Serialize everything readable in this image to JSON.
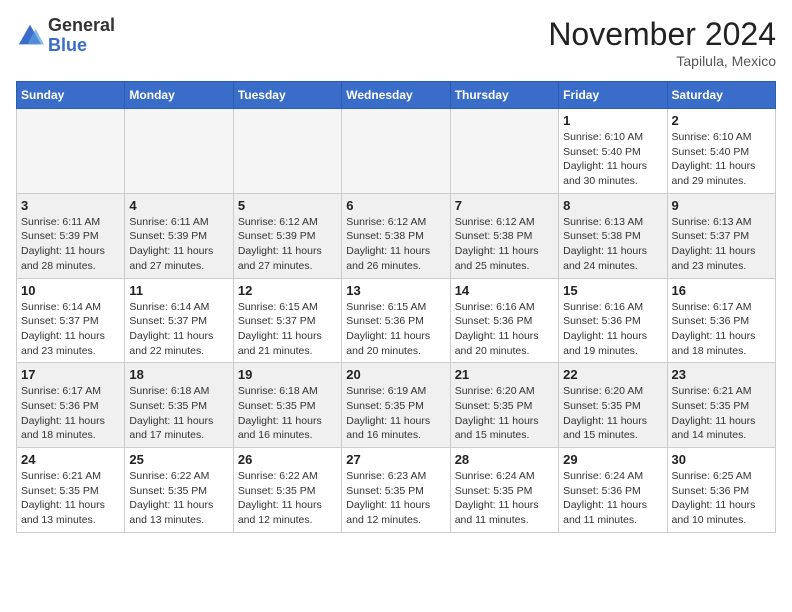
{
  "header": {
    "logo_general": "General",
    "logo_blue": "Blue",
    "month_title": "November 2024",
    "location": "Tapilula, Mexico"
  },
  "weekdays": [
    "Sunday",
    "Monday",
    "Tuesday",
    "Wednesday",
    "Thursday",
    "Friday",
    "Saturday"
  ],
  "weeks": [
    [
      {
        "day": "",
        "info": ""
      },
      {
        "day": "",
        "info": ""
      },
      {
        "day": "",
        "info": ""
      },
      {
        "day": "",
        "info": ""
      },
      {
        "day": "",
        "info": ""
      },
      {
        "day": "1",
        "info": "Sunrise: 6:10 AM\nSunset: 5:40 PM\nDaylight: 11 hours\nand 30 minutes."
      },
      {
        "day": "2",
        "info": "Sunrise: 6:10 AM\nSunset: 5:40 PM\nDaylight: 11 hours\nand 29 minutes."
      }
    ],
    [
      {
        "day": "3",
        "info": "Sunrise: 6:11 AM\nSunset: 5:39 PM\nDaylight: 11 hours\nand 28 minutes."
      },
      {
        "day": "4",
        "info": "Sunrise: 6:11 AM\nSunset: 5:39 PM\nDaylight: 11 hours\nand 27 minutes."
      },
      {
        "day": "5",
        "info": "Sunrise: 6:12 AM\nSunset: 5:39 PM\nDaylight: 11 hours\nand 27 minutes."
      },
      {
        "day": "6",
        "info": "Sunrise: 6:12 AM\nSunset: 5:38 PM\nDaylight: 11 hours\nand 26 minutes."
      },
      {
        "day": "7",
        "info": "Sunrise: 6:12 AM\nSunset: 5:38 PM\nDaylight: 11 hours\nand 25 minutes."
      },
      {
        "day": "8",
        "info": "Sunrise: 6:13 AM\nSunset: 5:38 PM\nDaylight: 11 hours\nand 24 minutes."
      },
      {
        "day": "9",
        "info": "Sunrise: 6:13 AM\nSunset: 5:37 PM\nDaylight: 11 hours\nand 23 minutes."
      }
    ],
    [
      {
        "day": "10",
        "info": "Sunrise: 6:14 AM\nSunset: 5:37 PM\nDaylight: 11 hours\nand 23 minutes."
      },
      {
        "day": "11",
        "info": "Sunrise: 6:14 AM\nSunset: 5:37 PM\nDaylight: 11 hours\nand 22 minutes."
      },
      {
        "day": "12",
        "info": "Sunrise: 6:15 AM\nSunset: 5:37 PM\nDaylight: 11 hours\nand 21 minutes."
      },
      {
        "day": "13",
        "info": "Sunrise: 6:15 AM\nSunset: 5:36 PM\nDaylight: 11 hours\nand 20 minutes."
      },
      {
        "day": "14",
        "info": "Sunrise: 6:16 AM\nSunset: 5:36 PM\nDaylight: 11 hours\nand 20 minutes."
      },
      {
        "day": "15",
        "info": "Sunrise: 6:16 AM\nSunset: 5:36 PM\nDaylight: 11 hours\nand 19 minutes."
      },
      {
        "day": "16",
        "info": "Sunrise: 6:17 AM\nSunset: 5:36 PM\nDaylight: 11 hours\nand 18 minutes."
      }
    ],
    [
      {
        "day": "17",
        "info": "Sunrise: 6:17 AM\nSunset: 5:36 PM\nDaylight: 11 hours\nand 18 minutes."
      },
      {
        "day": "18",
        "info": "Sunrise: 6:18 AM\nSunset: 5:35 PM\nDaylight: 11 hours\nand 17 minutes."
      },
      {
        "day": "19",
        "info": "Sunrise: 6:18 AM\nSunset: 5:35 PM\nDaylight: 11 hours\nand 16 minutes."
      },
      {
        "day": "20",
        "info": "Sunrise: 6:19 AM\nSunset: 5:35 PM\nDaylight: 11 hours\nand 16 minutes."
      },
      {
        "day": "21",
        "info": "Sunrise: 6:20 AM\nSunset: 5:35 PM\nDaylight: 11 hours\nand 15 minutes."
      },
      {
        "day": "22",
        "info": "Sunrise: 6:20 AM\nSunset: 5:35 PM\nDaylight: 11 hours\nand 15 minutes."
      },
      {
        "day": "23",
        "info": "Sunrise: 6:21 AM\nSunset: 5:35 PM\nDaylight: 11 hours\nand 14 minutes."
      }
    ],
    [
      {
        "day": "24",
        "info": "Sunrise: 6:21 AM\nSunset: 5:35 PM\nDaylight: 11 hours\nand 13 minutes."
      },
      {
        "day": "25",
        "info": "Sunrise: 6:22 AM\nSunset: 5:35 PM\nDaylight: 11 hours\nand 13 minutes."
      },
      {
        "day": "26",
        "info": "Sunrise: 6:22 AM\nSunset: 5:35 PM\nDaylight: 11 hours\nand 12 minutes."
      },
      {
        "day": "27",
        "info": "Sunrise: 6:23 AM\nSunset: 5:35 PM\nDaylight: 11 hours\nand 12 minutes."
      },
      {
        "day": "28",
        "info": "Sunrise: 6:24 AM\nSunset: 5:35 PM\nDaylight: 11 hours\nand 11 minutes."
      },
      {
        "day": "29",
        "info": "Sunrise: 6:24 AM\nSunset: 5:36 PM\nDaylight: 11 hours\nand 11 minutes."
      },
      {
        "day": "30",
        "info": "Sunrise: 6:25 AM\nSunset: 5:36 PM\nDaylight: 11 hours\nand 10 minutes."
      }
    ]
  ]
}
